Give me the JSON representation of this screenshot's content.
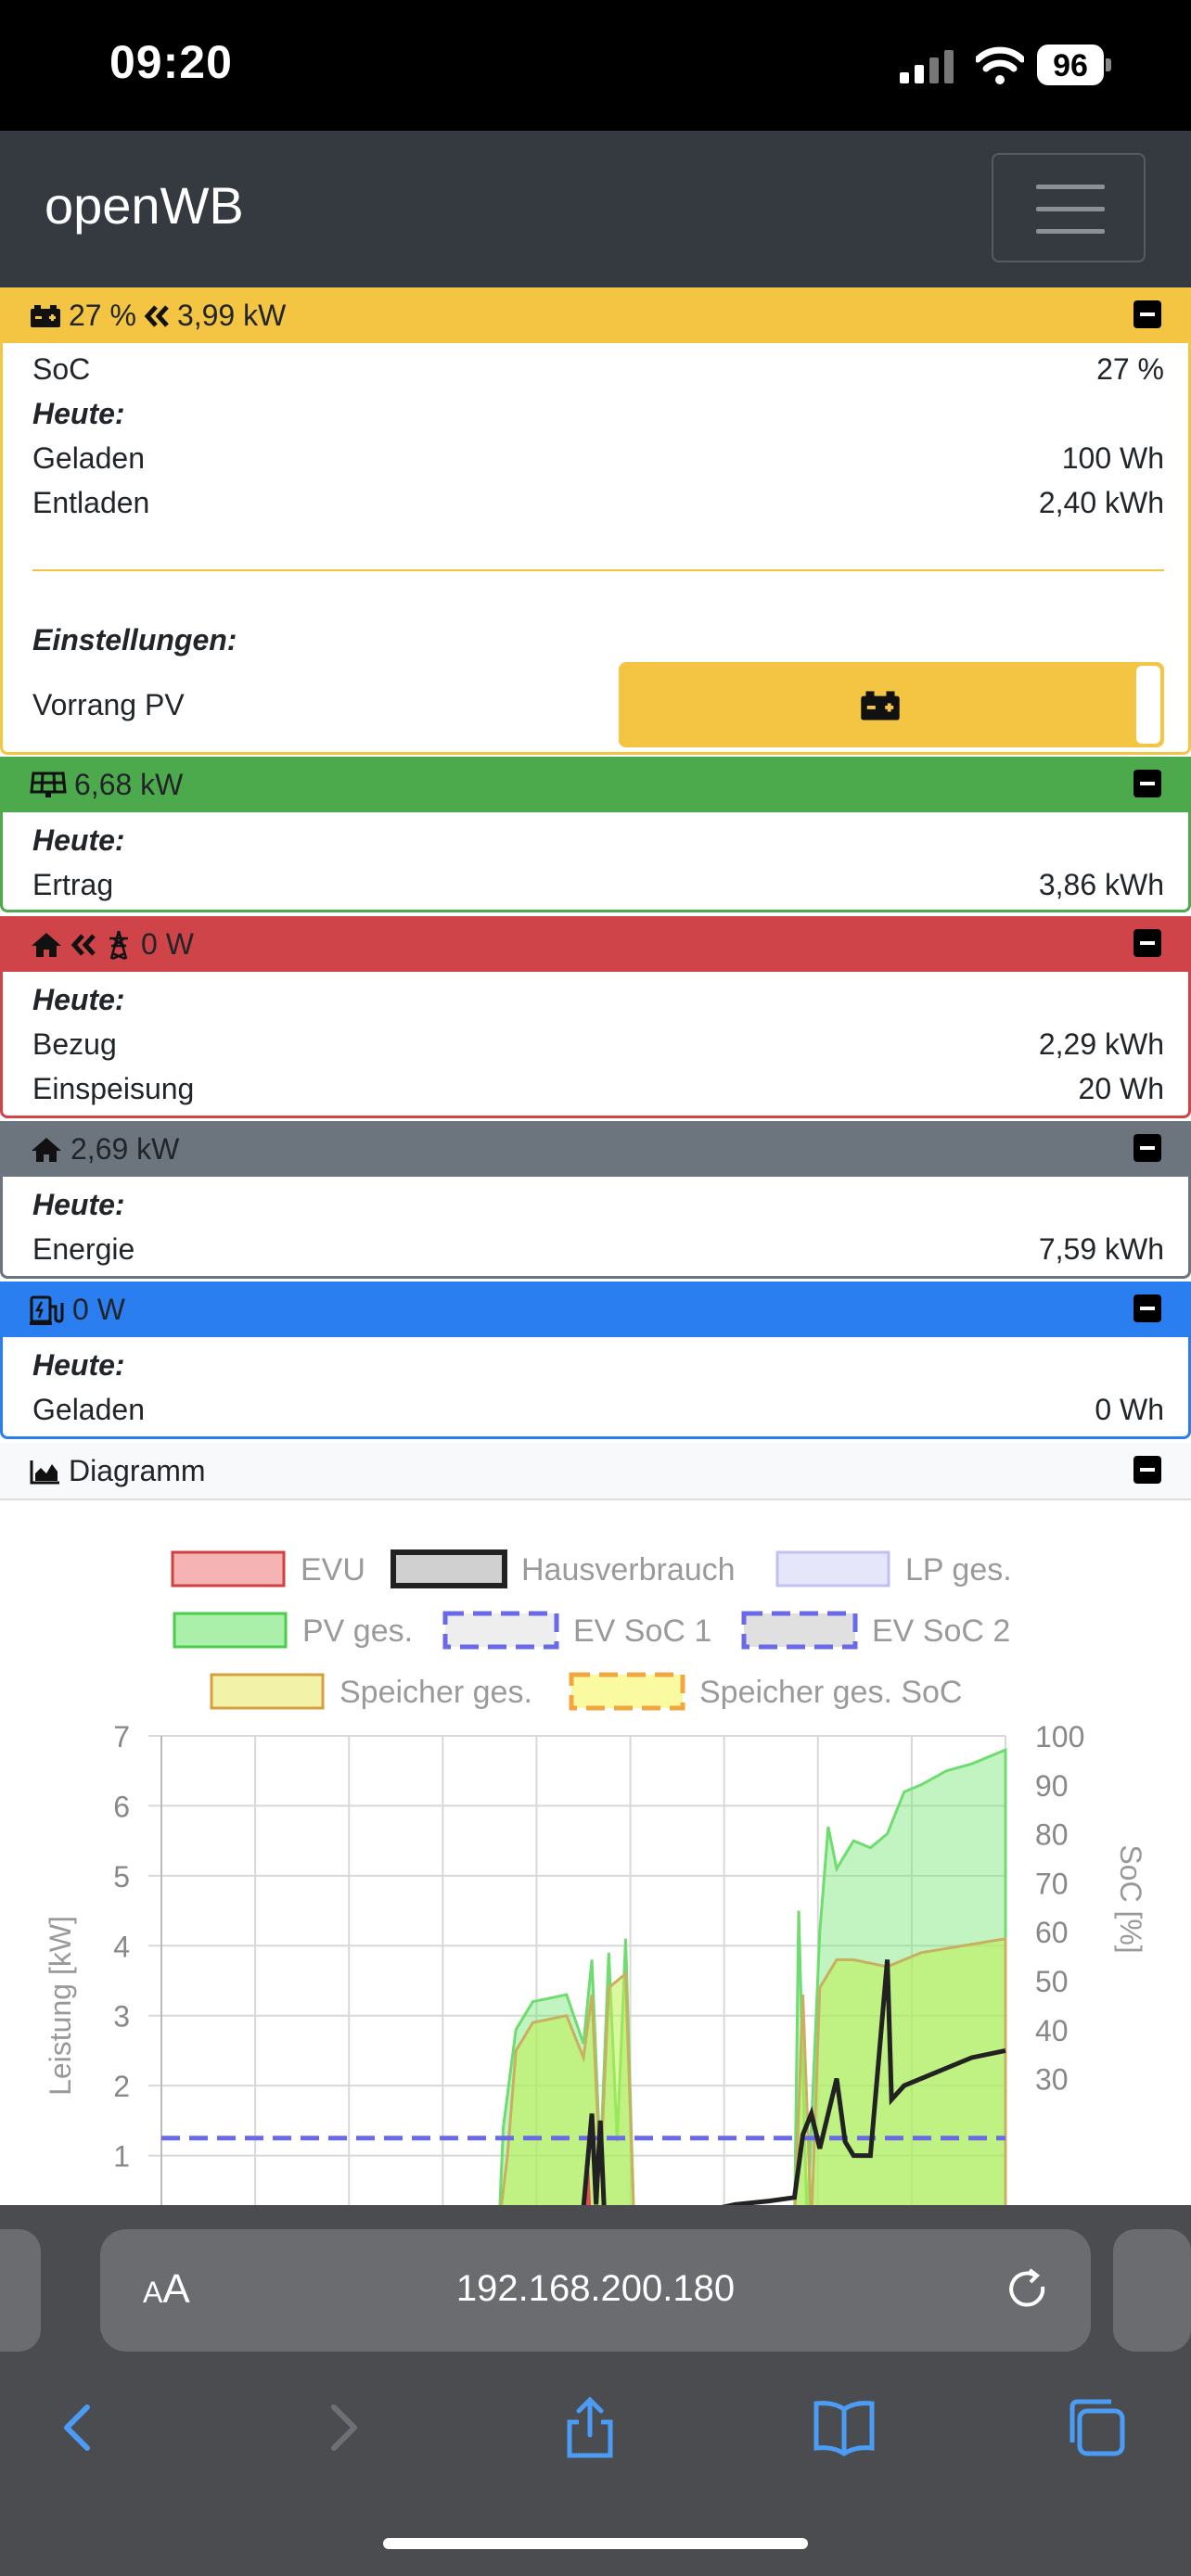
{
  "status": {
    "time": "09:20",
    "battery": "96"
  },
  "navbar": {
    "brand": "openWB"
  },
  "speicher": {
    "soc_header": "27 %",
    "power_header": "3,99 kW",
    "soc_label": "SoC",
    "soc_value": "27 %",
    "heute": "Heute:",
    "geladen_label": "Geladen",
    "geladen_value": "100 Wh",
    "entladen_label": "Entladen",
    "entladen_value": "2,40 kWh",
    "einstellungen": "Einstellungen:",
    "vorrang_label": "Vorrang PV",
    "color": "#f4c542"
  },
  "pv": {
    "header": "6,68 kW",
    "heute": "Heute:",
    "ertrag_label": "Ertrag",
    "ertrag_value": "3,86 kWh",
    "color": "#4caa4c"
  },
  "evu": {
    "header": "0 W",
    "heute": "Heute:",
    "bezug_label": "Bezug",
    "bezug_value": "2,29 kWh",
    "einspeisung_label": "Einspeisung",
    "einspeisung_value": "20 Wh",
    "color": "#cf4448"
  },
  "haus": {
    "header": "2,69 kW",
    "heute": "Heute:",
    "energie_label": "Energie",
    "energie_value": "7,59 kWh",
    "color": "#6c757d"
  },
  "lp": {
    "header": "0 W",
    "heute": "Heute:",
    "geladen_label": "Geladen",
    "geladen_value": "0 Wh",
    "color": "#2a7ef0"
  },
  "diagramm": {
    "header": "Diagramm",
    "legend": [
      "EVU",
      "Hausverbrauch",
      "LP ges.",
      "PV ges.",
      "EV SoC 1",
      "EV SoC 2",
      "Speicher ges.",
      "Speicher ges. SoC"
    ],
    "ylabel_left": "Leistung [kW]",
    "ylabel_right": "SoC [%]"
  },
  "chart_data": {
    "type": "area",
    "ylabel": "Leistung [kW]",
    "y2label": "SoC [%]",
    "ylim": [
      0,
      7
    ],
    "y2lim": [
      0,
      100
    ],
    "yticks": [
      1,
      2,
      3,
      4,
      5,
      6,
      7
    ],
    "y2ticks": [
      30,
      40,
      50,
      60,
      70,
      80,
      90,
      100
    ],
    "grid": true,
    "legend_position": "top",
    "series": [
      {
        "name": "EVU",
        "color": "#f4a6a6"
      },
      {
        "name": "Hausverbrauch",
        "color": "#222222"
      },
      {
        "name": "LP ges.",
        "color": "#d9d9f5"
      },
      {
        "name": "PV ges.",
        "color": "#7ee07e"
      },
      {
        "name": "EV SoC 1",
        "color": "#6a6ae8"
      },
      {
        "name": "EV SoC 2",
        "color": "#6a6ae8"
      },
      {
        "name": "Speicher ges.",
        "color": "#d6d66a"
      },
      {
        "name": "Speicher ges. SoC",
        "color": "#f2a640"
      }
    ],
    "ev_soc_1_level": 1.25,
    "pv": [
      [
        0,
        0
      ],
      [
        0.4,
        0
      ],
      [
        0.405,
        1.4
      ],
      [
        0.42,
        2.8
      ],
      [
        0.44,
        3.2
      ],
      [
        0.48,
        3.3
      ],
      [
        0.5,
        2.6
      ],
      [
        0.51,
        3.8
      ],
      [
        0.52,
        0.9
      ],
      [
        0.53,
        3.9
      ],
      [
        0.54,
        1.2
      ],
      [
        0.55,
        4.1
      ],
      [
        0.56,
        0
      ],
      [
        0.75,
        0
      ],
      [
        0.755,
        4.5
      ],
      [
        0.765,
        0
      ],
      [
        0.78,
        4.2
      ],
      [
        0.79,
        5.7
      ],
      [
        0.8,
        5.1
      ],
      [
        0.82,
        5.5
      ],
      [
        0.84,
        5.4
      ],
      [
        0.86,
        5.6
      ],
      [
        0.88,
        6.2
      ],
      [
        0.9,
        6.3
      ],
      [
        0.93,
        6.5
      ],
      [
        0.96,
        6.6
      ],
      [
        1.0,
        6.8
      ]
    ],
    "speicher": [
      [
        0,
        0
      ],
      [
        0.4,
        0
      ],
      [
        0.41,
        1.0
      ],
      [
        0.42,
        2.5
      ],
      [
        0.44,
        2.9
      ],
      [
        0.48,
        3.0
      ],
      [
        0.5,
        2.4
      ],
      [
        0.51,
        3.3
      ],
      [
        0.52,
        0.7
      ],
      [
        0.53,
        3.4
      ],
      [
        0.55,
        3.6
      ],
      [
        0.56,
        0
      ],
      [
        0.75,
        0
      ],
      [
        0.76,
        3.3
      ],
      [
        0.77,
        0
      ],
      [
        0.78,
        3.4
      ],
      [
        0.8,
        3.8
      ],
      [
        0.82,
        3.8
      ],
      [
        0.86,
        3.7
      ],
      [
        0.9,
        3.9
      ],
      [
        0.95,
        4.0
      ],
      [
        1.0,
        4.1
      ]
    ],
    "haus": [
      [
        0,
        0
      ],
      [
        0.2,
        0.05
      ],
      [
        0.22,
        0.1
      ],
      [
        0.26,
        0.15
      ],
      [
        0.3,
        0.05
      ],
      [
        0.4,
        0.1
      ],
      [
        0.44,
        0.15
      ],
      [
        0.48,
        0.2
      ],
      [
        0.5,
        0.25
      ],
      [
        0.51,
        1.6
      ],
      [
        0.515,
        0.3
      ],
      [
        0.52,
        1.5
      ],
      [
        0.525,
        0.1
      ],
      [
        0.55,
        0.2
      ],
      [
        0.6,
        0.1
      ],
      [
        0.64,
        0.2
      ],
      [
        0.68,
        0.3
      ],
      [
        0.72,
        0.35
      ],
      [
        0.75,
        0.4
      ],
      [
        0.76,
        1.3
      ],
      [
        0.77,
        1.6
      ],
      [
        0.78,
        1.1
      ],
      [
        0.8,
        2.1
      ],
      [
        0.81,
        1.2
      ],
      [
        0.82,
        1.0
      ],
      [
        0.84,
        1.0
      ],
      [
        0.86,
        3.8
      ],
      [
        0.865,
        1.8
      ],
      [
        0.88,
        2.0
      ],
      [
        0.92,
        2.2
      ],
      [
        0.96,
        2.4
      ],
      [
        1.0,
        2.5
      ]
    ]
  },
  "browser": {
    "aa": "AA",
    "url": "192.168.200.180"
  }
}
